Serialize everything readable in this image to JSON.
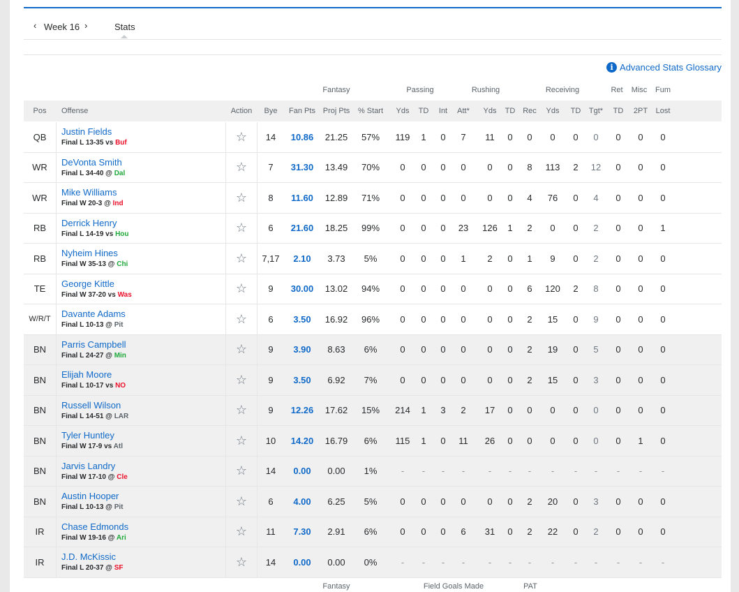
{
  "nav": {
    "prev_icon": "chevron-left-icon",
    "week_label": "Week 16",
    "next_icon": "chevron-right-icon",
    "tab_label": "Stats"
  },
  "glossary": {
    "icon": "info-icon",
    "label": "Advanced Stats Glossary"
  },
  "group_headers": [
    "Fantasy",
    "Passing",
    "Rushing",
    "Receiving",
    "Ret",
    "Misc",
    "Fum"
  ],
  "columns": [
    "Pos",
    "Offense",
    "Action",
    "Bye",
    "Fan Pts",
    "Proj Pts",
    "% Start",
    "Yds",
    "TD",
    "Int",
    "Att*",
    "Yds",
    "TD",
    "Rec",
    "Yds",
    "TD",
    "Tgt*",
    "TD",
    "2PT",
    "Lost"
  ],
  "players": [
    {
      "pos": "QB",
      "name": "Justin Fields",
      "info": "Final L 13-35 vs",
      "opp": "Buf",
      "opp_result": "loss",
      "bye": "14",
      "fan_pts": "10.86",
      "proj_pts": "21.25",
      "start": "57%",
      "stats": [
        "119",
        "1",
        "0",
        "7",
        "11",
        "0",
        "0",
        "0",
        "0",
        "0",
        "0",
        "0",
        "0"
      ],
      "bench": false
    },
    {
      "pos": "WR",
      "name": "DeVonta Smith",
      "info": "Final L 34-40 @",
      "opp": "Dal",
      "opp_result": "win",
      "bye": "7",
      "fan_pts": "31.30",
      "proj_pts": "13.49",
      "start": "70%",
      "stats": [
        "0",
        "0",
        "0",
        "0",
        "0",
        "0",
        "8",
        "113",
        "2",
        "12",
        "0",
        "0",
        "0"
      ],
      "bench": false
    },
    {
      "pos": "WR",
      "name": "Mike Williams",
      "info": "Final W 20-3 @",
      "opp": "Ind",
      "opp_result": "loss",
      "bye": "8",
      "fan_pts": "11.60",
      "proj_pts": "12.89",
      "start": "71%",
      "stats": [
        "0",
        "0",
        "0",
        "0",
        "0",
        "0",
        "4",
        "76",
        "0",
        "4",
        "0",
        "0",
        "0"
      ],
      "bench": false
    },
    {
      "pos": "RB",
      "name": "Derrick Henry",
      "info": "Final L 14-19 vs",
      "opp": "Hou",
      "opp_result": "win",
      "bye": "6",
      "fan_pts": "21.60",
      "proj_pts": "18.25",
      "start": "99%",
      "stats": [
        "0",
        "0",
        "0",
        "23",
        "126",
        "1",
        "2",
        "0",
        "0",
        "2",
        "0",
        "0",
        "1"
      ],
      "bench": false
    },
    {
      "pos": "RB",
      "name": "Nyheim Hines",
      "info": "Final W 35-13 @",
      "opp": "Chi",
      "opp_result": "win",
      "bye": "7,17",
      "fan_pts": "2.10",
      "proj_pts": "3.73",
      "start": "5%",
      "stats": [
        "0",
        "0",
        "0",
        "1",
        "2",
        "0",
        "1",
        "9",
        "0",
        "2",
        "0",
        "0",
        "0"
      ],
      "bench": false
    },
    {
      "pos": "TE",
      "name": "George Kittle",
      "info": "Final W 37-20 vs",
      "opp": "Was",
      "opp_result": "loss",
      "bye": "9",
      "fan_pts": "30.00",
      "proj_pts": "13.02",
      "start": "94%",
      "stats": [
        "0",
        "0",
        "0",
        "0",
        "0",
        "0",
        "6",
        "120",
        "2",
        "8",
        "0",
        "0",
        "0"
      ],
      "bench": false
    },
    {
      "pos": "W/R/T",
      "name": "Davante Adams",
      "info": "Final L 10-13 @",
      "opp": "Pit",
      "opp_result": "neutral",
      "bye": "6",
      "fan_pts": "3.50",
      "proj_pts": "16.92",
      "start": "96%",
      "stats": [
        "0",
        "0",
        "0",
        "0",
        "0",
        "0",
        "2",
        "15",
        "0",
        "9",
        "0",
        "0",
        "0"
      ],
      "bench": false
    },
    {
      "pos": "BN",
      "name": "Parris Campbell",
      "info": "Final L 24-27 @",
      "opp": "Min",
      "opp_result": "win",
      "bye": "9",
      "fan_pts": "3.90",
      "proj_pts": "8.63",
      "start": "6%",
      "stats": [
        "0",
        "0",
        "0",
        "0",
        "0",
        "0",
        "2",
        "19",
        "0",
        "5",
        "0",
        "0",
        "0"
      ],
      "bench": true
    },
    {
      "pos": "BN",
      "name": "Elijah Moore",
      "info": "Final L 10-17 vs",
      "opp": "NO",
      "opp_result": "loss",
      "bye": "9",
      "fan_pts": "3.50",
      "proj_pts": "6.92",
      "start": "7%",
      "stats": [
        "0",
        "0",
        "0",
        "0",
        "0",
        "0",
        "2",
        "15",
        "0",
        "3",
        "0",
        "0",
        "0"
      ],
      "bench": true
    },
    {
      "pos": "BN",
      "name": "Russell Wilson",
      "info": "Final L 14-51 @",
      "opp": "LAR",
      "opp_result": "neutral",
      "bye": "9",
      "fan_pts": "12.26",
      "proj_pts": "17.62",
      "start": "15%",
      "stats": [
        "214",
        "1",
        "3",
        "2",
        "17",
        "0",
        "0",
        "0",
        "0",
        "0",
        "0",
        "0",
        "0"
      ],
      "bench": true
    },
    {
      "pos": "BN",
      "name": "Tyler Huntley",
      "info": "Final W 17-9 vs",
      "opp": "Atl",
      "opp_result": "neutral",
      "bye": "10",
      "fan_pts": "14.20",
      "proj_pts": "16.79",
      "start": "6%",
      "stats": [
        "115",
        "1",
        "0",
        "11",
        "26",
        "0",
        "0",
        "0",
        "0",
        "0",
        "0",
        "1",
        "0"
      ],
      "bench": true
    },
    {
      "pos": "BN",
      "name": "Jarvis Landry",
      "info": "Final W 17-10 @",
      "opp": "Cle",
      "opp_result": "loss",
      "bye": "14",
      "fan_pts": "0.00",
      "proj_pts": "0.00",
      "start": "1%",
      "stats": [
        "-",
        "-",
        "-",
        "-",
        "-",
        "-",
        "-",
        "-",
        "-",
        "-",
        "-",
        "-",
        "-"
      ],
      "bench": true
    },
    {
      "pos": "BN",
      "name": "Austin Hooper",
      "info": "Final L 10-13 @",
      "opp": "Pit",
      "opp_result": "neutral",
      "bye": "6",
      "fan_pts": "4.00",
      "proj_pts": "6.25",
      "start": "5%",
      "stats": [
        "0",
        "0",
        "0",
        "0",
        "0",
        "0",
        "2",
        "20",
        "0",
        "3",
        "0",
        "0",
        "0"
      ],
      "bench": true
    },
    {
      "pos": "IR",
      "name": "Chase Edmonds",
      "info": "Final W 19-16 @",
      "opp": "Ari",
      "opp_result": "win",
      "bye": "11",
      "fan_pts": "7.30",
      "proj_pts": "2.91",
      "start": "6%",
      "stats": [
        "0",
        "0",
        "0",
        "6",
        "31",
        "0",
        "2",
        "22",
        "0",
        "2",
        "0",
        "0",
        "0"
      ],
      "bench": true
    },
    {
      "pos": "IR",
      "name": "J.D. McKissic",
      "info": "Final L 20-37 @",
      "opp": "SF",
      "opp_result": "loss",
      "bye": "14",
      "fan_pts": "0.00",
      "proj_pts": "0.00",
      "start": "0%",
      "stats": [
        "-",
        "-",
        "-",
        "-",
        "-",
        "-",
        "-",
        "-",
        "-",
        "-",
        "-",
        "-",
        "-"
      ],
      "bench": true
    }
  ],
  "footer_groups": [
    "Fantasy",
    "Field Goals Made",
    "PAT"
  ],
  "action_icon": "star-icon",
  "colors": {
    "link": "#0f69c8",
    "win": "#1ea83a",
    "loss": "#eb0f29",
    "bench_bg": "#f0f0f1",
    "accent_line": "#0f69c8"
  }
}
